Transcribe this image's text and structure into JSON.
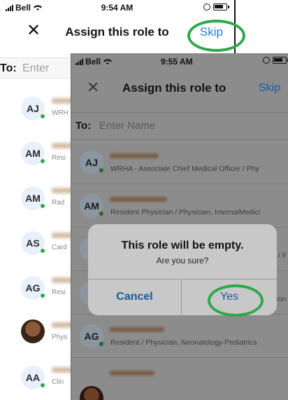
{
  "status_back": {
    "carrier": "Bell",
    "time": "9:54 AM"
  },
  "header_back": {
    "close": "✕",
    "title": "Assign this role to",
    "skip": "Skip"
  },
  "to_back": {
    "label": "To:",
    "placeholder": "Enter"
  },
  "rows_back": [
    {
      "initials": "AJ",
      "sub": "WRH"
    },
    {
      "initials": "AM",
      "sub": "Resi"
    },
    {
      "initials": "AM",
      "sub": "Rad"
    },
    {
      "initials": "AS",
      "sub": "Card"
    },
    {
      "initials": "AG",
      "sub": "Resi"
    },
    {
      "initials": "",
      "sub": "Phys"
    },
    {
      "initials": "AA",
      "sub": "Clin"
    }
  ],
  "status_front": {
    "carrier": "Bell",
    "time": "9:55 AM"
  },
  "header_front": {
    "close": "✕",
    "title": "Assign this role to",
    "skip": "Skip"
  },
  "to_front": {
    "label": "To:",
    "placeholder": "Enter Name"
  },
  "rows_front": [
    {
      "initials": "AJ",
      "sub": "WRHA - Associate Chief Medical Officer / Phy"
    },
    {
      "initials": "AM",
      "sub": "Resident Physician / Physician, InternalMedici"
    },
    {
      "initials": "A",
      "sub": "/ F"
    },
    {
      "initials": "A",
      "sub": "eon"
    },
    {
      "initials": "AG",
      "sub": "Resident / Physician, Neonatology-Pediatrics"
    },
    {
      "initials": "",
      "sub": ""
    }
  ],
  "dialog": {
    "title": "This role will be empty.",
    "message": "Are you sure?",
    "cancel": "Cancel",
    "yes": "Yes"
  },
  "colors": {
    "accent": "#1f7de0",
    "highlight_ring": "#2fa84a",
    "online_dot": "#2fa84a"
  }
}
